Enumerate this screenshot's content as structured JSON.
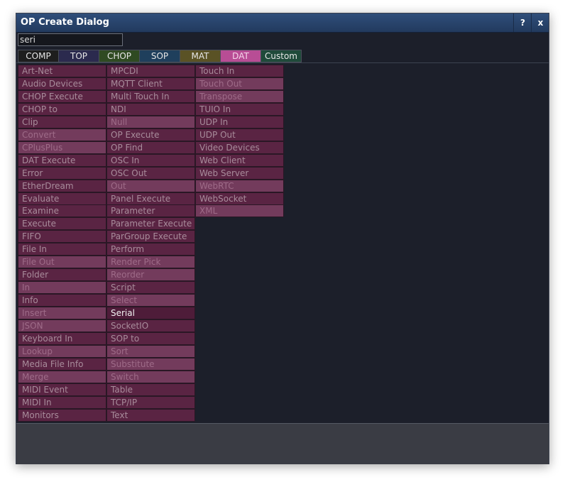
{
  "window": {
    "title": "OP Create Dialog",
    "help_label": "?",
    "close_label": "x"
  },
  "search": {
    "value": "seri"
  },
  "tabs": [
    {
      "label": "COMP",
      "bg": "#1e1e1e",
      "fg": "#e6e6e6"
    },
    {
      "label": "TOP",
      "bg": "#2b2a4e",
      "fg": "#e6e6e6"
    },
    {
      "label": "CHOP",
      "bg": "#2f4a22",
      "fg": "#e6e6e6"
    },
    {
      "label": "SOP",
      "bg": "#1f3f5c",
      "fg": "#e6e6e6"
    },
    {
      "label": "MAT",
      "bg": "#5a5225",
      "fg": "#e6e6e6"
    },
    {
      "label": "DAT",
      "bg": "#b84d95",
      "fg": "#f5d6ea",
      "selected": true
    },
    {
      "label": "Custom",
      "bg": "#1f4a3a",
      "fg": "#e6e6e6"
    }
  ],
  "operators": [
    [
      {
        "label": "Art-Net",
        "state": "avail"
      },
      {
        "label": "Audio Devices",
        "state": "avail"
      },
      {
        "label": "CHOP Execute",
        "state": "avail"
      },
      {
        "label": "CHOP to",
        "state": "avail"
      },
      {
        "label": "Clip",
        "state": "avail"
      },
      {
        "label": "Convert",
        "state": "dim"
      },
      {
        "label": "CPlusPlus",
        "state": "dim"
      },
      {
        "label": "DAT Execute",
        "state": "avail"
      },
      {
        "label": "Error",
        "state": "avail"
      },
      {
        "label": "EtherDream",
        "state": "avail"
      },
      {
        "label": "Evaluate",
        "state": "avail"
      },
      {
        "label": "Examine",
        "state": "avail"
      },
      {
        "label": "Execute",
        "state": "avail"
      },
      {
        "label": "FIFO",
        "state": "avail"
      },
      {
        "label": "File In",
        "state": "avail"
      },
      {
        "label": "File Out",
        "state": "dim"
      },
      {
        "label": "Folder",
        "state": "avail"
      },
      {
        "label": "In",
        "state": "dim"
      },
      {
        "label": "Info",
        "state": "avail"
      },
      {
        "label": "Insert",
        "state": "dim"
      },
      {
        "label": "JSON",
        "state": "dim"
      },
      {
        "label": "Keyboard In",
        "state": "avail"
      },
      {
        "label": "Lookup",
        "state": "dim"
      },
      {
        "label": "Media File Info",
        "state": "avail"
      },
      {
        "label": "Merge",
        "state": "dim"
      },
      {
        "label": "MIDI Event",
        "state": "avail"
      },
      {
        "label": "MIDI In",
        "state": "avail"
      },
      {
        "label": "Monitors",
        "state": "avail"
      }
    ],
    [
      {
        "label": "MPCDI",
        "state": "avail"
      },
      {
        "label": "MQTT Client",
        "state": "avail"
      },
      {
        "label": "Multi Touch In",
        "state": "avail"
      },
      {
        "label": "NDI",
        "state": "avail"
      },
      {
        "label": "Null",
        "state": "dim"
      },
      {
        "label": "OP Execute",
        "state": "avail"
      },
      {
        "label": "OP Find",
        "state": "avail"
      },
      {
        "label": "OSC In",
        "state": "avail"
      },
      {
        "label": "OSC Out",
        "state": "avail"
      },
      {
        "label": "Out",
        "state": "dim"
      },
      {
        "label": "Panel Execute",
        "state": "avail"
      },
      {
        "label": "Parameter",
        "state": "avail"
      },
      {
        "label": "Parameter Execute",
        "state": "avail"
      },
      {
        "label": "ParGroup Execute",
        "state": "avail"
      },
      {
        "label": "Perform",
        "state": "avail"
      },
      {
        "label": "Render Pick",
        "state": "dim"
      },
      {
        "label": "Reorder",
        "state": "dim"
      },
      {
        "label": "Script",
        "state": "avail"
      },
      {
        "label": "Select",
        "state": "dim"
      },
      {
        "label": "Serial",
        "state": "match"
      },
      {
        "label": "SocketIO",
        "state": "avail"
      },
      {
        "label": "SOP to",
        "state": "avail"
      },
      {
        "label": "Sort",
        "state": "dim"
      },
      {
        "label": "Substitute",
        "state": "dim"
      },
      {
        "label": "Switch",
        "state": "dim"
      },
      {
        "label": "Table",
        "state": "avail"
      },
      {
        "label": "TCP/IP",
        "state": "avail"
      },
      {
        "label": "Text",
        "state": "avail"
      }
    ],
    [
      {
        "label": "Touch In",
        "state": "avail"
      },
      {
        "label": "Touch Out",
        "state": "dim"
      },
      {
        "label": "Transpose",
        "state": "dim"
      },
      {
        "label": "TUIO In",
        "state": "avail"
      },
      {
        "label": "UDP In",
        "state": "avail"
      },
      {
        "label": "UDP Out",
        "state": "avail"
      },
      {
        "label": "Video Devices",
        "state": "avail"
      },
      {
        "label": "Web Client",
        "state": "avail"
      },
      {
        "label": "Web Server",
        "state": "avail"
      },
      {
        "label": "WebRTC",
        "state": "dim"
      },
      {
        "label": "WebSocket",
        "state": "avail"
      },
      {
        "label": "XML",
        "state": "dim"
      }
    ]
  ]
}
